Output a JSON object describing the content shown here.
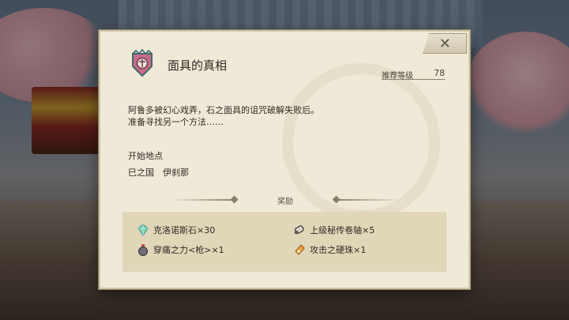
{
  "dialog": {
    "title": "面具的真相",
    "level_label": "推荐等级",
    "level_value": "78",
    "description_line1": "阿鲁多被幻心戏弄，石之面具的诅咒破解失败后。",
    "description_line2": "准备寻找另一个方法……",
    "start_label": "开始地点",
    "start_value": "巳之国　伊刹那",
    "reward_title": "奖励",
    "close_icon": "close-icon",
    "emblem_icon": "crest-emblem-icon"
  },
  "rewards": [
    {
      "label": "克洛诺斯石×30",
      "icon": "crystal-icon"
    },
    {
      "label": "上级秘传卷轴×5",
      "icon": "scroll-icon"
    },
    {
      "label": "穿痛之力<枪>×1",
      "icon": "potion-icon"
    },
    {
      "label": "攻击之硬珠×1",
      "icon": "gem-icon"
    }
  ],
  "colors": {
    "panel": "#efe9d8",
    "reward_box": "#e0d6b8",
    "text": "#2f2a24"
  }
}
